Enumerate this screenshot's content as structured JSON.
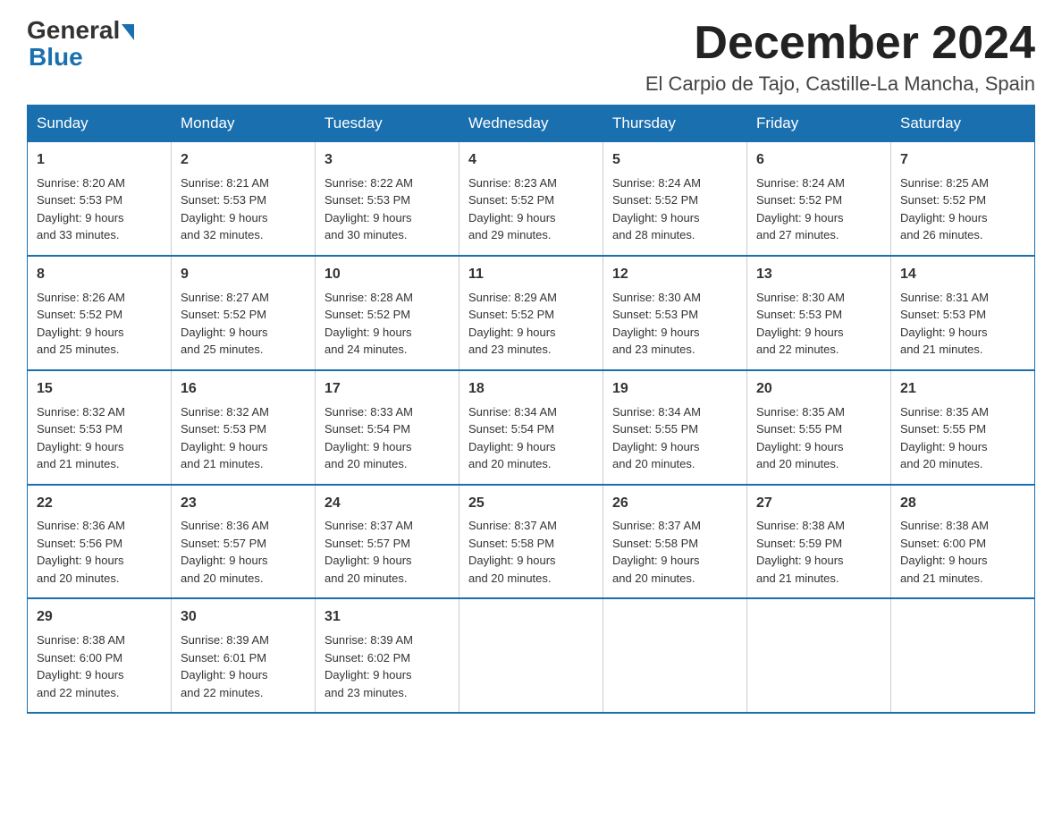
{
  "header": {
    "logo_general": "General",
    "logo_blue": "Blue",
    "month_title": "December 2024",
    "location": "El Carpio de Tajo, Castille-La Mancha, Spain"
  },
  "weekdays": [
    "Sunday",
    "Monday",
    "Tuesday",
    "Wednesday",
    "Thursday",
    "Friday",
    "Saturday"
  ],
  "weeks": [
    [
      {
        "day": "1",
        "sunrise": "8:20 AM",
        "sunset": "5:53 PM",
        "daylight": "9 hours and 33 minutes."
      },
      {
        "day": "2",
        "sunrise": "8:21 AM",
        "sunset": "5:53 PM",
        "daylight": "9 hours and 32 minutes."
      },
      {
        "day": "3",
        "sunrise": "8:22 AM",
        "sunset": "5:53 PM",
        "daylight": "9 hours and 30 minutes."
      },
      {
        "day": "4",
        "sunrise": "8:23 AM",
        "sunset": "5:52 PM",
        "daylight": "9 hours and 29 minutes."
      },
      {
        "day": "5",
        "sunrise": "8:24 AM",
        "sunset": "5:52 PM",
        "daylight": "9 hours and 28 minutes."
      },
      {
        "day": "6",
        "sunrise": "8:24 AM",
        "sunset": "5:52 PM",
        "daylight": "9 hours and 27 minutes."
      },
      {
        "day": "7",
        "sunrise": "8:25 AM",
        "sunset": "5:52 PM",
        "daylight": "9 hours and 26 minutes."
      }
    ],
    [
      {
        "day": "8",
        "sunrise": "8:26 AM",
        "sunset": "5:52 PM",
        "daylight": "9 hours and 25 minutes."
      },
      {
        "day": "9",
        "sunrise": "8:27 AM",
        "sunset": "5:52 PM",
        "daylight": "9 hours and 25 minutes."
      },
      {
        "day": "10",
        "sunrise": "8:28 AM",
        "sunset": "5:52 PM",
        "daylight": "9 hours and 24 minutes."
      },
      {
        "day": "11",
        "sunrise": "8:29 AM",
        "sunset": "5:52 PM",
        "daylight": "9 hours and 23 minutes."
      },
      {
        "day": "12",
        "sunrise": "8:30 AM",
        "sunset": "5:53 PM",
        "daylight": "9 hours and 23 minutes."
      },
      {
        "day": "13",
        "sunrise": "8:30 AM",
        "sunset": "5:53 PM",
        "daylight": "9 hours and 22 minutes."
      },
      {
        "day": "14",
        "sunrise": "8:31 AM",
        "sunset": "5:53 PM",
        "daylight": "9 hours and 21 minutes."
      }
    ],
    [
      {
        "day": "15",
        "sunrise": "8:32 AM",
        "sunset": "5:53 PM",
        "daylight": "9 hours and 21 minutes."
      },
      {
        "day": "16",
        "sunrise": "8:32 AM",
        "sunset": "5:53 PM",
        "daylight": "9 hours and 21 minutes."
      },
      {
        "day": "17",
        "sunrise": "8:33 AM",
        "sunset": "5:54 PM",
        "daylight": "9 hours and 20 minutes."
      },
      {
        "day": "18",
        "sunrise": "8:34 AM",
        "sunset": "5:54 PM",
        "daylight": "9 hours and 20 minutes."
      },
      {
        "day": "19",
        "sunrise": "8:34 AM",
        "sunset": "5:55 PM",
        "daylight": "9 hours and 20 minutes."
      },
      {
        "day": "20",
        "sunrise": "8:35 AM",
        "sunset": "5:55 PM",
        "daylight": "9 hours and 20 minutes."
      },
      {
        "day": "21",
        "sunrise": "8:35 AM",
        "sunset": "5:55 PM",
        "daylight": "9 hours and 20 minutes."
      }
    ],
    [
      {
        "day": "22",
        "sunrise": "8:36 AM",
        "sunset": "5:56 PM",
        "daylight": "9 hours and 20 minutes."
      },
      {
        "day": "23",
        "sunrise": "8:36 AM",
        "sunset": "5:57 PM",
        "daylight": "9 hours and 20 minutes."
      },
      {
        "day": "24",
        "sunrise": "8:37 AM",
        "sunset": "5:57 PM",
        "daylight": "9 hours and 20 minutes."
      },
      {
        "day": "25",
        "sunrise": "8:37 AM",
        "sunset": "5:58 PM",
        "daylight": "9 hours and 20 minutes."
      },
      {
        "day": "26",
        "sunrise": "8:37 AM",
        "sunset": "5:58 PM",
        "daylight": "9 hours and 20 minutes."
      },
      {
        "day": "27",
        "sunrise": "8:38 AM",
        "sunset": "5:59 PM",
        "daylight": "9 hours and 21 minutes."
      },
      {
        "day": "28",
        "sunrise": "8:38 AM",
        "sunset": "6:00 PM",
        "daylight": "9 hours and 21 minutes."
      }
    ],
    [
      {
        "day": "29",
        "sunrise": "8:38 AM",
        "sunset": "6:00 PM",
        "daylight": "9 hours and 22 minutes."
      },
      {
        "day": "30",
        "sunrise": "8:39 AM",
        "sunset": "6:01 PM",
        "daylight": "9 hours and 22 minutes."
      },
      {
        "day": "31",
        "sunrise": "8:39 AM",
        "sunset": "6:02 PM",
        "daylight": "9 hours and 23 minutes."
      },
      null,
      null,
      null,
      null
    ]
  ]
}
